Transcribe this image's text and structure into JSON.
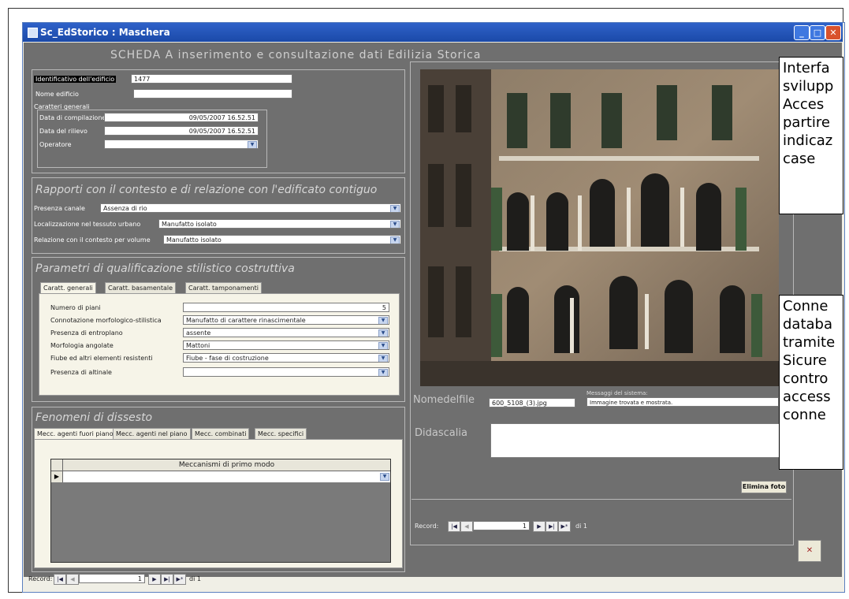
{
  "window": {
    "title": "Sc_EdStorico : Maschera",
    "min": "_",
    "max": "□",
    "close": "✕"
  },
  "header": "SCHEDA  A  inserimento e consultazione dati Edilizia Storica",
  "general": {
    "id_label": "Identificativo dell'edificio",
    "id_value": "1477",
    "name_label": "Nome edificio",
    "name_value": "",
    "caratteri_label": "Caratteri generali",
    "data_comp_label": "Data di compilazione",
    "data_comp_value": "09/05/2007 16.52.51",
    "data_ril_label": "Data del rilievo",
    "data_ril_value": "09/05/2007 16.52.51",
    "operatore_label": "Operatore",
    "operatore_value": ""
  },
  "rapporti": {
    "title": "Rapporti con il contesto e di relazione con l'edificato contiguo",
    "presenza_label": "Presenza canale",
    "presenza_value": "Assenza di rio",
    "local_label": "Localizzazione nel tessuto urbano",
    "local_value": "Manufatto isolato",
    "rel_label": "Relazione con il contesto per volume",
    "rel_value": "Manufatto isolato"
  },
  "parametri": {
    "title": "Parametri di qualificazione stilistico costruttiva",
    "tabs": [
      "Caratt. generali",
      "Caratt. basamentale",
      "Caratt. tamponamenti"
    ],
    "rows": [
      {
        "label": "Numero di piani",
        "value": "5"
      },
      {
        "label": "Connotazione morfologico-stilistica",
        "value": "Manufatto di carattere rinascimentale"
      },
      {
        "label": "Presenza di entroplano",
        "value": "assente"
      },
      {
        "label": "Morfologia angolate",
        "value": "Mattoni"
      },
      {
        "label": "Fiube ed altri elementi resistenti",
        "value": "Fiube - fase di costruzione"
      },
      {
        "label": "Presenza di altinale",
        "value": ""
      }
    ]
  },
  "fenomeni": {
    "title": "Fenomeni di dissesto",
    "tabs": [
      "Mecc. agenti fuori piano",
      "Mecc. agenti nel piano",
      "Mecc. combinati",
      "Mecc. specifici"
    ],
    "column": "Meccanismi di primo modo"
  },
  "photo_panel": {
    "nomefile_label": "Nomedelfile",
    "nomefile_value": "600_5108_(3).jpg",
    "messaggi_label": "Messaggi del sistema:",
    "messaggi_value": "Immagine trovata e mostrata.",
    "didascalia_label": "Didascalia",
    "elimina_label": "Elimina foto"
  },
  "records": {
    "label": "Record:",
    "current": "1",
    "of": "di 1"
  },
  "callouts": {
    "first": [
      "Interfa",
      "svilupp",
      "Acces",
      "partire",
      "indicaz",
      "case"
    ],
    "second": [
      "Conne",
      "databa",
      "tramite",
      "Sicure",
      "contro",
      "access",
      "conne"
    ]
  }
}
